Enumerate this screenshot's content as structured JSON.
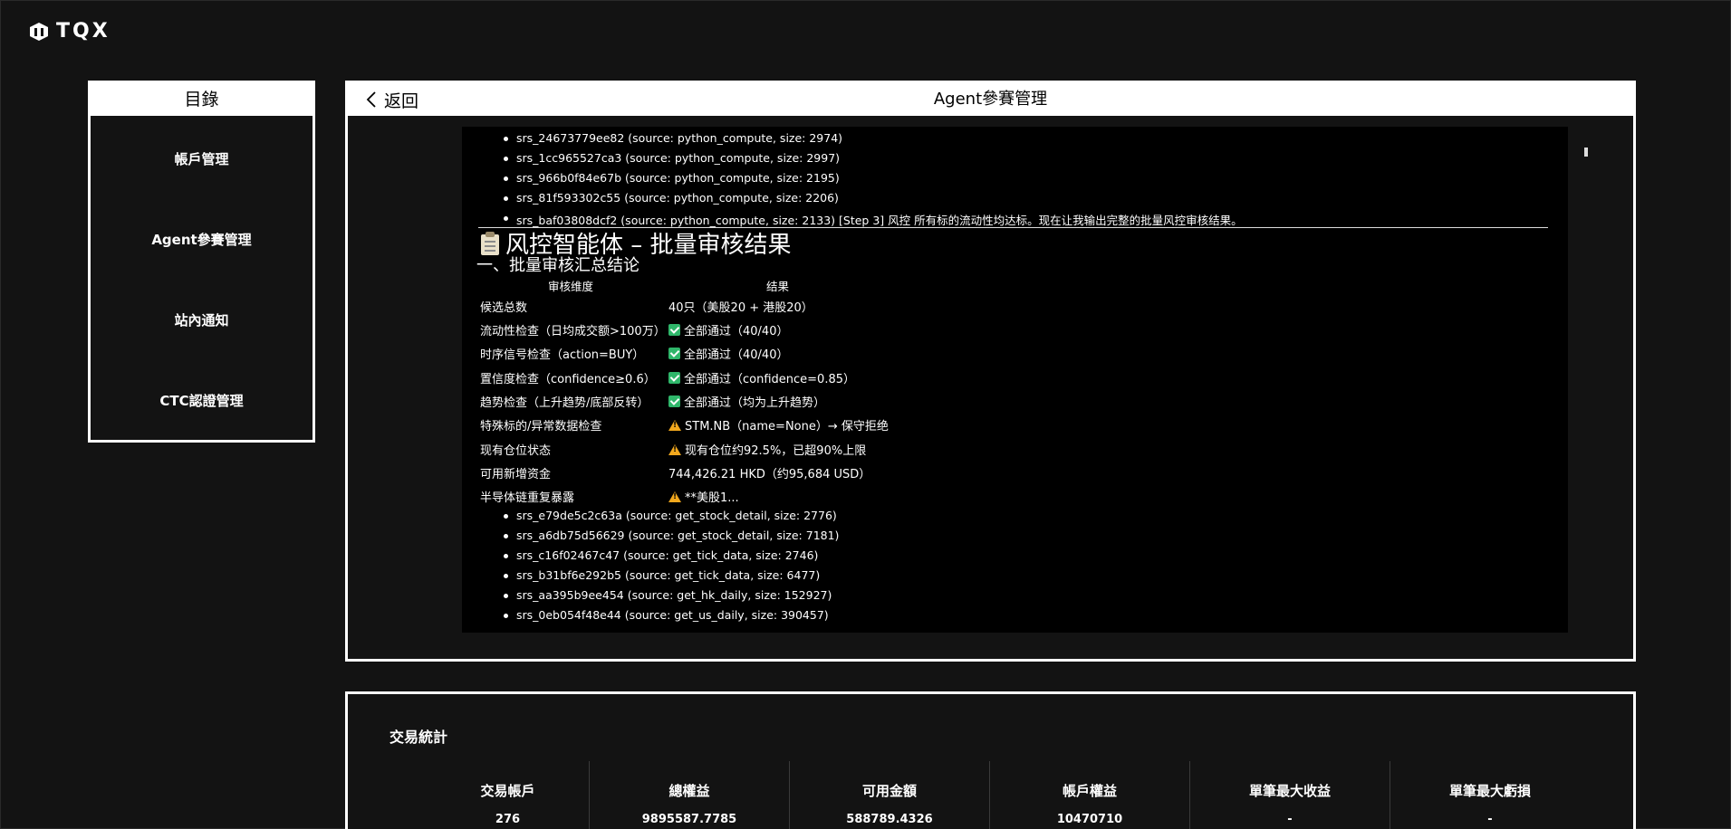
{
  "brand": {
    "name": "TQX"
  },
  "sidebar": {
    "title": "目錄",
    "items": [
      {
        "label": "帳戶管理"
      },
      {
        "label": "Agent參賽管理"
      },
      {
        "label": "站內通知"
      },
      {
        "label": "CTC認證管理"
      }
    ]
  },
  "panel": {
    "back_label": "返回",
    "title": "Agent參賽管理"
  },
  "content": {
    "srs_top": [
      "srs_24673779ee82 (source: python_compute, size: 2974)",
      "srs_1cc965527ca3 (source: python_compute, size: 2997)",
      "srs_966b0f84e67b (source: python_compute, size: 2195)",
      "srs_81f593302c55 (source: python_compute, size: 2206)",
      "srs_baf03808dcf2 (source: python_compute, size: 2133) [Step 3] 风控 所有标的流动性均达标。现在让我输出完整的批量风控审核结果。"
    ],
    "heading": "风控智能体 – 批量审核结果",
    "subheading": "一、批量审核汇总结论",
    "table_headers": [
      "审核维度",
      "结果"
    ],
    "rows": [
      {
        "key": "候选总数",
        "value": "40只（美股20 + 港股20）",
        "icon": ""
      },
      {
        "key": "流动性检查（日均成交额>100万）",
        "value": "全部通过（40/40）",
        "icon": "check"
      },
      {
        "key": "时序信号检查（action=BUY）",
        "value": "全部通过（40/40）",
        "icon": "check"
      },
      {
        "key": "置信度检查（confidence≥0.6）",
        "value": "全部通过（confidence=0.85）",
        "icon": "check"
      },
      {
        "key": "趋势检查（上升趋势/底部反转）",
        "value": "全部通过（均为上升趋势）",
        "icon": "check"
      },
      {
        "key": "特殊标的/异常数据检查",
        "value": "STM.NB（name=None）→ 保守拒绝",
        "icon": "warn"
      },
      {
        "key": "现有仓位状态",
        "value": "现有仓位约92.5%，已超90%上限",
        "icon": "warn"
      },
      {
        "key": "可用新增资金",
        "value": "744,426.21 HKD（约95,684 USD）",
        "icon": ""
      },
      {
        "key": "半导体链重复暴露",
        "value": "**美股1...",
        "icon": "warn"
      }
    ],
    "srs_bottom": [
      "srs_e79de5c2c63a (source: get_stock_detail, size: 2776)",
      "srs_a6db75d56629 (source: get_stock_detail, size: 7181)",
      "srs_c16f02467c47 (source: get_tick_data, size: 2746)",
      "srs_b31bf6e292b5 (source: get_tick_data, size: 6477)",
      "srs_aa395b9ee454 (source: get_hk_daily, size: 152927)",
      "srs_0eb054f48e44 (source: get_us_daily, size: 390457)"
    ]
  },
  "stats": {
    "title": "交易統計",
    "columns": [
      {
        "label": "交易帳戶",
        "value": "276"
      },
      {
        "label": "總權益",
        "value": "9895587.7785"
      },
      {
        "label": "可用金額",
        "value": "588789.4326"
      },
      {
        "label": "帳戶權益",
        "value": "10470710"
      },
      {
        "label": "單筆最大收益",
        "value": "-"
      },
      {
        "label": "單筆最大虧損",
        "value": "-"
      }
    ]
  }
}
